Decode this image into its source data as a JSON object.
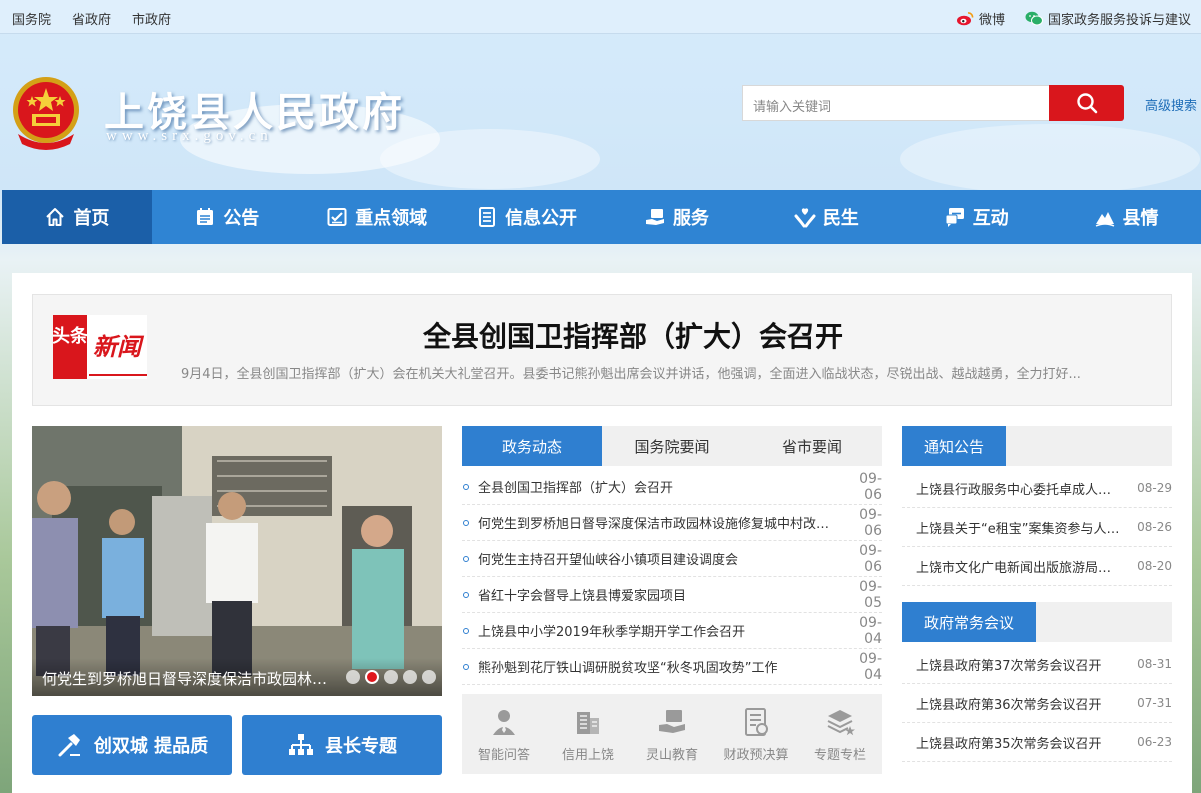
{
  "topbar": {
    "links": [
      "国务院",
      "省政府",
      "市政府"
    ],
    "weibo": "微博",
    "complaint": "国家政务服务投诉与建议"
  },
  "header": {
    "title": "上饶县人民政府",
    "url": "www.srx.gov.cn",
    "search_placeholder": "请输入关键词",
    "advanced_search": "高级搜索"
  },
  "nav": [
    {
      "label": "首页",
      "icon": "home-icon"
    },
    {
      "label": "公告",
      "icon": "notice-icon"
    },
    {
      "label": "重点领域",
      "icon": "checklist-icon"
    },
    {
      "label": "信息公开",
      "icon": "document-icon"
    },
    {
      "label": "服务",
      "icon": "service-icon"
    },
    {
      "label": "民生",
      "icon": "hands-icon"
    },
    {
      "label": "互动",
      "icon": "chat-icon"
    },
    {
      "label": "县情",
      "icon": "mountain-icon"
    }
  ],
  "headline": {
    "badge_left": "头条",
    "badge_right": "新闻",
    "title": "全县创国卫指挥部（扩大）会召开",
    "summary": "9月4日，全县创国卫指挥部（扩大）会在机关大礼堂召开。县委书记熊孙魁出席会议并讲话，他强调，全面进入临战状态，尽锐出战、越战越勇，全力打好..."
  },
  "slider": {
    "caption": "何党生到罗桥旭日督导深度保洁市政园林设施修复城中村改造工作",
    "dots": 5,
    "active_dot": 2
  },
  "big_buttons": [
    {
      "label": "创双城 提品质",
      "icon": "hammer-icon"
    },
    {
      "label": "县长专题",
      "icon": "org-chart-icon"
    }
  ],
  "news": {
    "tabs": [
      "政务动态",
      "国务院要闻",
      "省市要闻"
    ],
    "active_tab": 0,
    "items": [
      {
        "title": "全县创国卫指挥部（扩大）会召开",
        "date": "09-06"
      },
      {
        "title": "何党生到罗桥旭日督导深度保洁市政园林设施修复城中村改造工作",
        "date": "09-06"
      },
      {
        "title": "何党生主持召开望仙峡谷小镇项目建设调度会",
        "date": "09-06"
      },
      {
        "title": "省红十字会督导上饶县博爱家园项目",
        "date": "09-05"
      },
      {
        "title": "上饶县中小学2019年秋季学期开学工作会召开",
        "date": "09-04"
      },
      {
        "title": "熊孙魁到花厅铁山调研脱贫攻坚“秋冬巩固攻势”工作",
        "date": "09-04"
      }
    ]
  },
  "quick_links": [
    {
      "label": "智能问答",
      "icon": "person-icon"
    },
    {
      "label": "信用上饶",
      "icon": "building-icon"
    },
    {
      "label": "灵山教育",
      "icon": "education-icon"
    },
    {
      "label": "财政预决算",
      "icon": "budget-icon"
    },
    {
      "label": "专题专栏",
      "icon": "topics-icon"
    }
  ],
  "notices": {
    "title": "通知公告",
    "items": [
      {
        "title": "上饶县行政服务中心委托卓成人力资源公司招聘工作人员公告",
        "date": "08-29"
      },
      {
        "title": "上饶县关于“e租宝”案集资参与人信息核实登记的公告",
        "date": "08-26"
      },
      {
        "title": "上饶市文化广电新闻出版旅游局关于公开征集意见的公告",
        "date": "08-20"
      }
    ]
  },
  "meetings": {
    "title": "政府常务会议",
    "items": [
      {
        "title": "上饶县政府第37次常务会议召开",
        "date": "08-31"
      },
      {
        "title": "上饶县政府第36次常务会议召开",
        "date": "07-31"
      },
      {
        "title": "上饶县政府第35次常务会议召开",
        "date": "06-23"
      }
    ]
  },
  "colors": {
    "nav_blue": "#2f84d3",
    "nav_active": "#1b5fa8",
    "accent_blue": "#2f7fd0",
    "search_red": "#d9161c"
  }
}
